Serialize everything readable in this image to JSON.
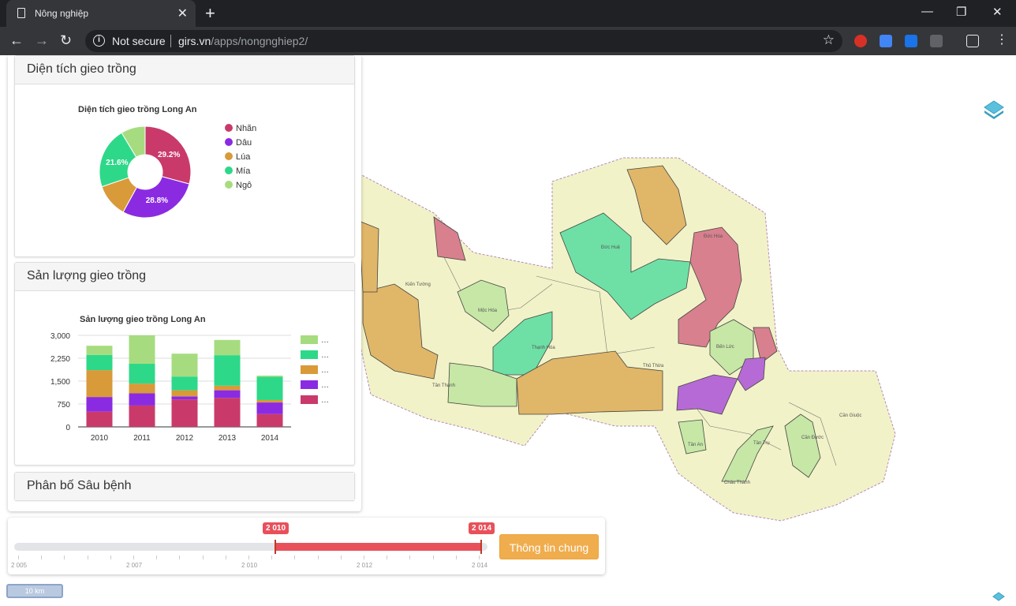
{
  "browser": {
    "tab_title": "Nông nghiệp",
    "new_tab": "+",
    "not_secure": "Not secure",
    "url_host": "girs.vn",
    "url_path": "/apps/nongnghiep2/"
  },
  "panels": {
    "area": {
      "heading": "Diện tích gieo trồng",
      "chart_title": "Diện tích gieo trồng Long An"
    },
    "yield": {
      "heading": "Sản lượng gieo trồng",
      "chart_title": "Sản lượng gieo trồng Long An"
    },
    "pest": {
      "heading": "Phân bố Sâu bệnh"
    }
  },
  "colors": {
    "nhan": "#c93a6b",
    "dau": "#8a2be2",
    "lua": "#d99a3a",
    "mia": "#2ed889",
    "ngo": "#a6dc7f"
  },
  "chart_data": [
    {
      "type": "pie",
      "title": "Diện tích gieo trồng Long An",
      "labels": [
        "Nhãn",
        "Dâu",
        "Lúa",
        "Mía",
        "Ngô"
      ],
      "values": [
        29.2,
        28.8,
        11.8,
        21.6,
        8.6
      ],
      "data_labels": [
        "29.2%",
        "28.8%",
        "21.6%"
      ],
      "legend": "right"
    },
    {
      "type": "bar",
      "title": "Sản lượng gieo trồng Long An",
      "categories": [
        "2010",
        "2011",
        "2012",
        "2013",
        "2014"
      ],
      "yticks": [
        "0",
        "750",
        "1,500",
        "2,250",
        "3,000"
      ],
      "ylim": [
        0,
        3000
      ],
      "stacked": true,
      "series": [
        {
          "key": "nhan",
          "values": [
            500,
            700,
            900,
            950,
            420
          ]
        },
        {
          "key": "dau",
          "values": [
            480,
            400,
            100,
            250,
            380
          ]
        },
        {
          "key": "lua",
          "values": [
            880,
            320,
            200,
            150,
            80
          ]
        },
        {
          "key": "mia",
          "values": [
            500,
            650,
            450,
            1000,
            760
          ]
        },
        {
          "key": "ngo",
          "values": [
            300,
            930,
            750,
            500,
            40
          ]
        }
      ],
      "legend_entries": [
        "…",
        "…",
        "…",
        "…",
        "…"
      ],
      "legend": "right"
    }
  ],
  "timeline": {
    "start_flag": "2 010",
    "end_flag": "2 014",
    "range_start": 2010,
    "range_end": 2014,
    "labels": [
      "2 005",
      "2 007",
      "2 010",
      "2 012",
      "2 014"
    ],
    "info_button": "Thông tin chung"
  },
  "map": {
    "scale_label": "10 km",
    "district_labels": [
      "Kiến Tường",
      "Mộc Hóa",
      "Đức Huệ",
      "Đức Hòa",
      "Thạnh Hóa",
      "Tân Thạnh",
      "Thủ Thừa",
      "Bến Lức",
      "Cần Giuộc",
      "Cần Đước",
      "Tân Trụ",
      "Châu Thành",
      "Tân An"
    ]
  }
}
